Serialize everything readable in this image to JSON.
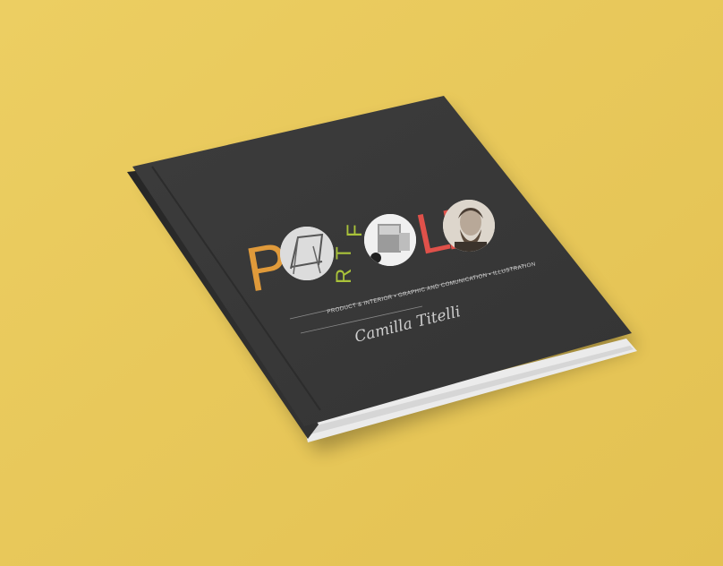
{
  "colors": {
    "background": "#e8c757",
    "cover": "#3a3a3a",
    "spine": "#2b2b2b",
    "pages": "#ececec",
    "letter_orange": "#e09a3a",
    "letter_green": "#a9c23a",
    "letter_red": "#e0514a"
  },
  "cover": {
    "title_letters": [
      "P",
      "O",
      "R",
      "T",
      "F",
      "O",
      "L",
      "I",
      "O"
    ],
    "subtitle": "PRODUCT & INTERIOR  •  GRAPHIC AND COMUNICATION  •  ILLUSTRATION",
    "signature": "Camilla Titelli"
  }
}
